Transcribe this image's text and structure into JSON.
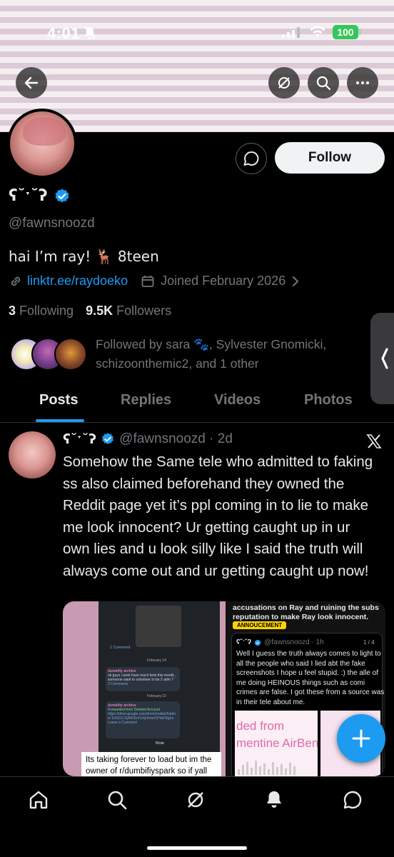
{
  "status_bar": {
    "time": "4:01",
    "battery": "100"
  },
  "colors": {
    "accent": "#1d9bf0",
    "battery": "#34c759",
    "follow_bg": "#eff3f4"
  },
  "profile": {
    "display_name": "ʕ˘ˑ˘ʔ",
    "handle": "@fawnsnoozd",
    "bio": "hai I’m ray! 🦌 8teen",
    "link": "linktr.ee/raydoeko",
    "joined": "Joined February 2026",
    "following_count": "3",
    "following_label": " Following",
    "followers_count": "9.5K",
    "followers_label": " Followers",
    "followed_by": "Followed by sara 🐾, Sylvester Gnomicki, schizoonthemic2, and 1 other",
    "follow_button": "Follow"
  },
  "tabs": [
    "Posts",
    "Replies",
    "Videos",
    "Photos"
  ],
  "tweet": {
    "name": "ʕ˘ˑ˘ʔ",
    "handle_time": "@fawnsnoozd · 2d",
    "text": "Somehow the Same tele who admitted to faking ss also claimed beforehand they owned the Reddit page yet it’s ppl coming in to lie to make me look innocent? Ur getting caught up in ur own lies and u look silly like I said the truth will always come out and ur getting caught up now!",
    "media": {
      "left_caption": "Its taking forever to load but im the owner of r/dumbifiyspark so if yall",
      "right_header": "accusations on Ray and ruining the subs reputation to make Ray look innocent.",
      "badge": "ANNOUCEMENT",
      "inner_name": "ʕ˘ˑ˘ʔ",
      "inner_handle": "@fawnsnoozd · 1h",
      "inner_count": "1 / 4",
      "inner_text": "Well I guess the truth always comes to light to all the people who said I lied abt the fake screenshots I hope u feel stupid. :) the alle of me doing HEINOUS things such as comi crimes are false. I got these from a source was in their tele about me.",
      "img_line1": "ded from",
      "img_line2": "mentine AirBen",
      "chat_lines": [
        "1 Comment",
        "February 14",
        "dumbifiy archive",
        "ok guys i wont have much time this month , someone want to volunteer to be 2 adm ?",
        "3 Comments",
        "February 22",
        "dumbifiy archive",
        "Forwarded from Deleted Account",
        "https://drive.google.com/drive/mobile/folders/ 1hGCU-3yRKSvV1rQnImeZ1HaFl3g2a",
        "Leave a Comment",
        "Mute"
      ]
    }
  },
  "nav_icons": [
    "home-icon",
    "search-icon",
    "grok-icon",
    "notifications-icon",
    "messages-icon"
  ]
}
